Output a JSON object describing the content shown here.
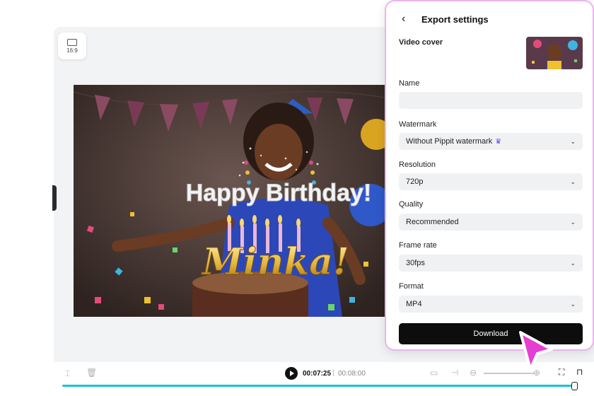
{
  "aspect_ratio": {
    "label": "16:9"
  },
  "export_panel": {
    "title": "Export settings",
    "video_cover_label": "Video cover",
    "name_label": "Name",
    "name_value": "",
    "watermark_label": "Watermark",
    "watermark_value": "Without Pippit watermark",
    "resolution_label": "Resolution",
    "resolution_value": "720p",
    "quality_label": "Quality",
    "quality_value": "Recommended",
    "frame_rate_label": "Frame rate",
    "frame_rate_value": "30fps",
    "format_label": "Format",
    "format_value": "MP4",
    "download_label": "Download"
  },
  "player": {
    "current_time": "00:07:25",
    "separator": "|",
    "total_time": "00:08:00",
    "progress": 0.99
  },
  "video_overlay": {
    "line1": "Happy Birthday!",
    "line2": "Minka!"
  },
  "colors": {
    "accent": "#17c4d4",
    "cursor": "#e53fd1",
    "panel_border": "#e9b4ee",
    "crown": "#6c4cf0"
  }
}
